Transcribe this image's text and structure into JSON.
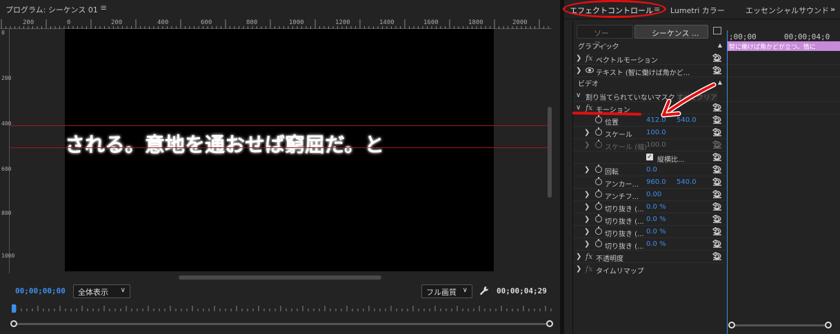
{
  "program": {
    "title": "プログラム: シーケンス 01",
    "menu_glyph": "≡",
    "ruler_labels": [
      "200",
      "0",
      "200",
      "400",
      "600",
      "800",
      "1000",
      "1200",
      "1400",
      "1600",
      "1800",
      "2000"
    ],
    "vruler_labels": [
      "0",
      "200",
      "400",
      "600",
      "800",
      "1000"
    ],
    "caption": "される。意地を通おせば窮屈だ。と",
    "timecode_current": "00;00;00;00",
    "zoom_dropdown": "全体表示",
    "quality_dropdown": "フル画質",
    "timecode_duration": "00;00;04;29"
  },
  "tabs": {
    "effect_controls": "エフェクトコントロール",
    "effect_menu": "≡",
    "lumetri": "Lumetri カラー",
    "essential_sound": "エッセンシャルサウンド",
    "more": "»"
  },
  "effect_controls": {
    "source_label": "ソース・...",
    "sequence_label": "シーケンス ...",
    "section_graphic": "グラフィック",
    "section_video": "ビデオ",
    "rows": {
      "vector_motion": "ベクトルモーション",
      "text_layer": "テキスト (智に働けば角かど...",
      "unassigned_mask": "割り当てられていないマスク",
      "clear_all": "すべてクリア",
      "motion": "モーション",
      "position": "位置",
      "position_x": "412.0",
      "position_y": "540.0",
      "scale": "スケール",
      "scale_value": "100.0",
      "scale_width": "スケール (幅)",
      "scale_width_value": "100.0",
      "uniform_scale": "縦横比...",
      "rotation": "回転",
      "rotation_value": "0.0",
      "anchor": "アンカー...",
      "anchor_x": "960.0",
      "anchor_y": "540.0",
      "antiflicker": "アンチフ...",
      "antiflicker_value": "0.00",
      "crop1": "切り抜き (...",
      "crop1_value": "0.0 %",
      "crop2": "切り抜き (...",
      "crop2_value": "0.0 %",
      "crop3": "切り抜き (...",
      "crop3_value": "0.0 %",
      "crop4": "切り抜き (...",
      "crop4_value": "0.0 %",
      "opacity": "不透明度",
      "time_remap": "タイムリマップ"
    },
    "timeline": {
      "tc_start": ";00;00",
      "tc_end": "00;00;04;0",
      "clip_label": "智に働けば角かどが立つ。情に"
    }
  },
  "colors": {
    "accent_blue": "#3d8eef",
    "annotation_red": "#e01010",
    "clip_purple": "#c78ad9"
  }
}
